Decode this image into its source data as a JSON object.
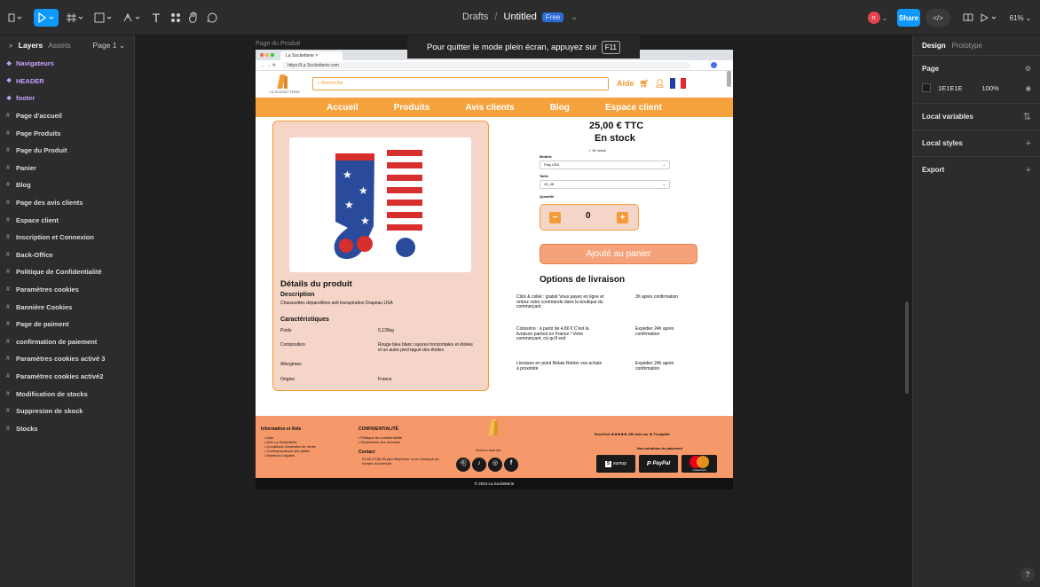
{
  "app": {
    "drafts": "Drafts",
    "sep": "/",
    "file": "Untitled",
    "plan": "Free",
    "share": "Share",
    "zoom": "61%",
    "avatar": "n"
  },
  "toolbar": {
    "text_tool": "T"
  },
  "left_panel": {
    "tab_layers": "Layers",
    "tab_assets": "Assets",
    "page": "Page 1",
    "layers": [
      {
        "name": "Navigateurs",
        "type": "component"
      },
      {
        "name": "HEADER",
        "type": "component"
      },
      {
        "name": "footer",
        "type": "component"
      },
      {
        "name": "Page d'accueil",
        "type": "frame"
      },
      {
        "name": "Page Produits",
        "type": "frame"
      },
      {
        "name": "Page du Produit",
        "type": "frame"
      },
      {
        "name": "Panier",
        "type": "frame"
      },
      {
        "name": "Blog",
        "type": "frame"
      },
      {
        "name": "Page des avis clients",
        "type": "frame"
      },
      {
        "name": "Espace client",
        "type": "frame"
      },
      {
        "name": "Inscription et Connexion",
        "type": "frame"
      },
      {
        "name": "Back-Office",
        "type": "frame"
      },
      {
        "name": "Politique de Confidentialité",
        "type": "frame"
      },
      {
        "name": "Paramètres cookies",
        "type": "frame"
      },
      {
        "name": "Bannière Cookies",
        "type": "frame"
      },
      {
        "name": "Page de paiment",
        "type": "frame"
      },
      {
        "name": "confirmation de paiement",
        "type": "frame"
      },
      {
        "name": "Paramètres cookies activé 3",
        "type": "frame"
      },
      {
        "name": "Paramètres cookies activé2",
        "type": "frame"
      },
      {
        "name": "Modification de stocks",
        "type": "frame"
      },
      {
        "name": "Suppresion de skock",
        "type": "frame"
      },
      {
        "name": "Stocks",
        "type": "frame"
      }
    ]
  },
  "right_panel": {
    "tab_design": "Design",
    "tab_prototype": "Prototype",
    "page_title": "Page",
    "page_color": "1E1E1E",
    "page_opacity": "100%",
    "local_variables": "Local variables",
    "local_styles": "Local styles",
    "export": "Export"
  },
  "canvas": {
    "frame_label": "Page du Produit",
    "toast": "Pour quitter le mode plein écran, appuyez sur",
    "toast_key": "F11",
    "help": "?"
  },
  "site": {
    "tab_title": "La Socketterie",
    "url": "https://La Socketterie.com",
    "logo_text": "LA SOCKETTERIE",
    "search_placeholder": "Recherche",
    "help": "Aide",
    "nav": [
      "Accueil",
      "Produits",
      "Avis clients",
      "Blog",
      "Espace client"
    ],
    "details_title": "Détails du produit",
    "description_title": "Description",
    "description": "Chaussettes dépareillées anti transpiration Drapeau USA",
    "carac_title": "Caractéristiques",
    "specs": [
      {
        "label": "Poids",
        "value": "0,135kg"
      },
      {
        "label": "Composition",
        "value": "Rouge bleu blanc rayures horizontales et étoiles et un autre pied tagué des étoiles"
      },
      {
        "label": "Allergènes",
        "value": ""
      },
      {
        "label": "Origine",
        "value": "France"
      }
    ],
    "price": "25,00 € TTC",
    "stock": "En stock",
    "stock_badge": "✓ En stock",
    "model_label": "Modèle",
    "model_value": "Flag USA",
    "size_label": "Taille",
    "size_value": "43_46",
    "qty_label": "Quantité",
    "qty": "0",
    "minus": "−",
    "plus": "+",
    "add_cart": "Ajouté au panier",
    "shipping_title": "Options de livraison",
    "shipping": [
      {
        "desc": "Click & collet : gratuit Vous payez en ligne et retirez votre commande dans la boutique du commerçant.",
        "delay": "3h après confirmation"
      },
      {
        "desc": "Colissimo : à partir de 4,80 € C'est la livraison partout en France ! Votre commerçant, où qu'il soit",
        "delay": "Expédier 24h après confirmation"
      },
      {
        "desc": "Livraison en point Relais Retirer vos achats à proximité",
        "delay": "Expédier 24h après confirmation"
      }
    ],
    "footer": {
      "info_title": "Information et Aide",
      "info_items": [
        "• Aide",
        "• Avis La Socketterie",
        "• Conditions Générales de Vente",
        "• Correspondance des tailles",
        "• Mentions Légales"
      ],
      "conf_title": "CONFIDENTIALITÉ",
      "conf_items": [
        "• Politique de confidentialité",
        "• Paramètres des données"
      ],
      "contact_title": "Contact",
      "contact": "01.65.23.56.36 part téléphone ou en boutique au horaire d'ouverture",
      "follow": "Suivez-nous sur",
      "trust": "Excellent ★★★★★ 436 avis sur ★ Trustpilot",
      "pay_title": "Nos solutions de paiement",
      "sumup": "sumup",
      "paypal": "PayPal",
      "mastercard": "mastercard"
    },
    "copyright": "© 2024 La Socketterie"
  }
}
